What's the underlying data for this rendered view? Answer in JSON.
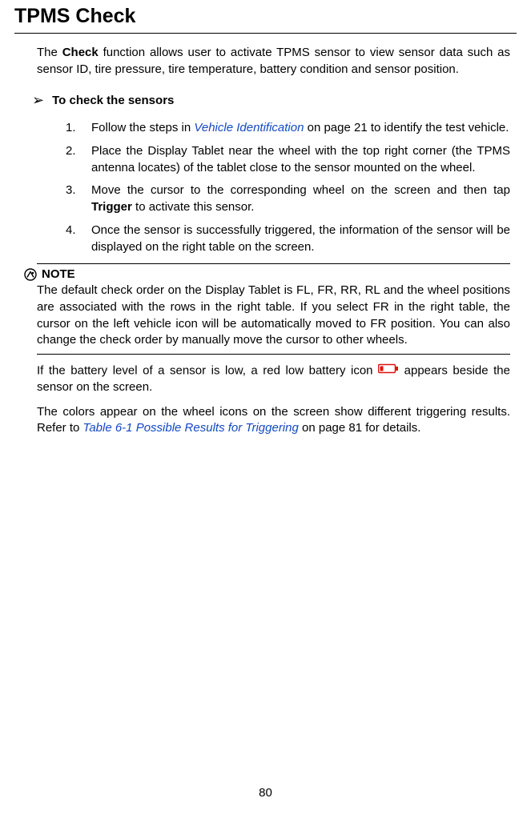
{
  "title": "TPMS Check",
  "intro_parts": {
    "a": "The ",
    "b": "Check",
    "c": " function allows user to activate TPMS sensor to view sensor data such as sensor ID, tire pressure, tire temperature, battery condition and sensor position."
  },
  "h2": "To check the sensors",
  "steps": [
    {
      "num": "1.",
      "pre": "Follow the steps in ",
      "link": "Vehicle Identification",
      "post": " on page 21 to identify the test vehicle."
    },
    {
      "num": "2.",
      "text": "Place the Display Tablet near the wheel with the top right corner (the TPMS antenna locates) of the tablet close to the sensor mounted on the wheel."
    },
    {
      "num": "3.",
      "pre": "Move the cursor to the corresponding wheel on the screen and then tap ",
      "bold": "Trigger",
      "post": " to activate this sensor."
    },
    {
      "num": "4.",
      "text": "Once the sensor is successfully triggered, the information of the sensor will be displayed on the right table on the screen."
    }
  ],
  "note_label": "NOTE",
  "note_body": "The default check order on the Display Tablet is FL, FR, RR, RL and the wheel positions are associated with the rows in the right table. If you select FR in the right table, the cursor on the left vehicle icon will be automatically moved to FR position. You can also change the check order by manually move the cursor to other wheels.",
  "battery_para": {
    "pre": "If the battery level of a sensor is low, a red low battery icon ",
    "post": " appears beside the sensor on the screen."
  },
  "colors_para": {
    "pre": "The colors appear on the wheel icons on the screen show different triggering results. Refer to ",
    "link": "Table 6-1 Possible Results for Triggering",
    "post": " on page 81 for details."
  },
  "page_number": "80"
}
